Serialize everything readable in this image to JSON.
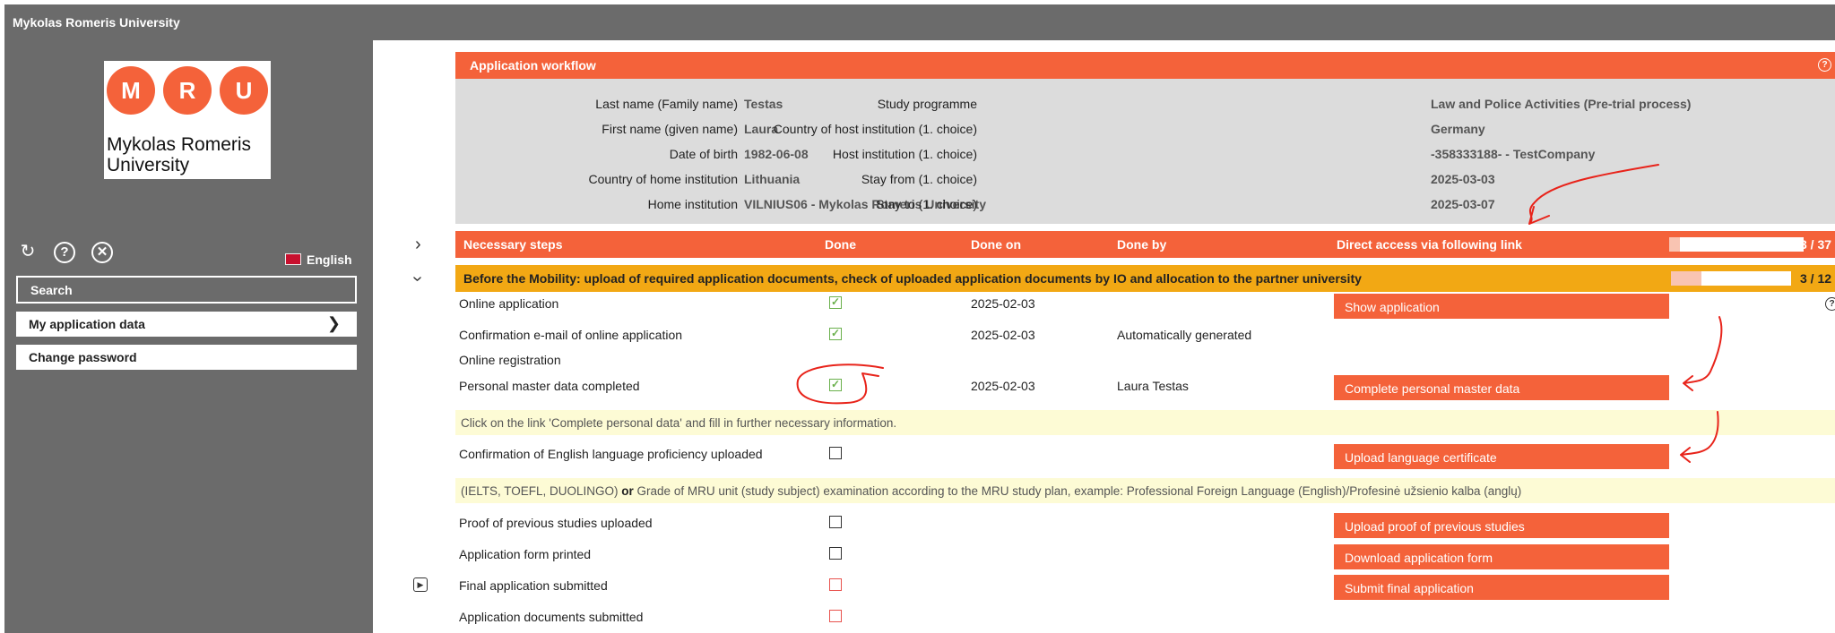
{
  "app": {
    "title": "Mykolas Romeris University"
  },
  "logo": {
    "letters": [
      "M",
      "R",
      "U"
    ],
    "line1": "Mykolas Romeris",
    "line2": "University",
    "brand_color": "#f4623a"
  },
  "sidebar": {
    "icons": [
      "refresh-icon",
      "help-icon",
      "close-icon"
    ],
    "language": "English",
    "search_label": "Search",
    "items": [
      {
        "label": "My application data"
      },
      {
        "label": "Change password"
      }
    ]
  },
  "workflow": {
    "header": "Application workflow",
    "left_fields": [
      {
        "label": "Last name (Family name)",
        "value": "Testas"
      },
      {
        "label": "First name (given name)",
        "value": "Laura"
      },
      {
        "label": "Date of birth",
        "value": "1982-06-08"
      },
      {
        "label": "Country of home institution",
        "value": "Lithuania"
      },
      {
        "label": "Home institution",
        "value": "VILNIUS06 - Mykolas Romeris University"
      }
    ],
    "right_fields": [
      {
        "label": "Study programme",
        "value": "Law and Police Activities (Pre-trial process)"
      },
      {
        "label": "Country of host institution (1. choice)",
        "value": "Germany"
      },
      {
        "label": "Host institution (1. choice)",
        "value": "-358333188- - TestCompany"
      },
      {
        "label": "Stay from (1. choice)",
        "value": "2025-03-03"
      },
      {
        "label": "Stay to (1. choice)",
        "value": "2025-03-07"
      }
    ]
  },
  "steps": {
    "columns": {
      "step": "Necessary steps",
      "done": "Done",
      "done_on": "Done on",
      "done_by": "Done by",
      "link": "Direct access via following link"
    },
    "progress": {
      "label": "3 / 37",
      "fraction": 0.081
    },
    "section": {
      "title": "Before the Mobility: upload of required application documents, check of uploaded application documents by IO and allocation to the partner university",
      "progress": {
        "label": "3 / 12",
        "fraction": 0.25
      }
    },
    "rows": [
      {
        "name": "Online application",
        "done": "checked",
        "done_on": "2025-02-03",
        "done_by": "",
        "button": "Show application"
      },
      {
        "name": "Confirmation e-mail of online application",
        "done": "checked",
        "done_on": "2025-02-03",
        "done_by": "Automatically generated",
        "button": ""
      },
      {
        "name": "Online registration",
        "done": "",
        "done_on": "",
        "done_by": "",
        "button": ""
      },
      {
        "name": "Personal master data completed",
        "done": "checked",
        "done_on": "2025-02-03",
        "done_by": "Laura Testas",
        "button": "Complete personal master data"
      },
      {
        "name": "Confirmation of English language proficiency uploaded",
        "done": "unchecked",
        "done_on": "",
        "done_by": "",
        "button": "Upload language certificate"
      },
      {
        "name": "Proof of previous studies uploaded",
        "done": "unchecked",
        "done_on": "",
        "done_by": "",
        "button": "Upload proof of previous studies"
      },
      {
        "name": "Application form printed",
        "done": "unchecked",
        "done_on": "",
        "done_by": "",
        "button": "Download application form"
      },
      {
        "name": "Final application submitted",
        "done": "pending",
        "done_on": "",
        "done_by": "",
        "button": "Submit final application"
      },
      {
        "name": "Application documents submitted",
        "done": "pending",
        "done_on": "",
        "done_by": "",
        "button": ""
      }
    ],
    "notes": {
      "personal_data": "Click on the link 'Complete personal data' and fill in further necessary information.",
      "language_pre": "(IELTS, TOEFL, DUOLINGO) ",
      "language_bold": "or",
      "language_post": " Grade of MRU unit (study subject) examination according to the MRU study plan, example: Professional Foreign Language (English)/Profesinė užsienio kalba (anglų)"
    }
  },
  "colors": {
    "orange": "#f4623a",
    "section_amber": "#f2a814",
    "sidebar_gray": "#6b6b6b",
    "info_gray": "#dcdcdc",
    "note_yellow": "#fdfbd5",
    "check_green": "#6ab04c",
    "pending_red": "#e8534e",
    "annotation_red": "#e8231a"
  }
}
